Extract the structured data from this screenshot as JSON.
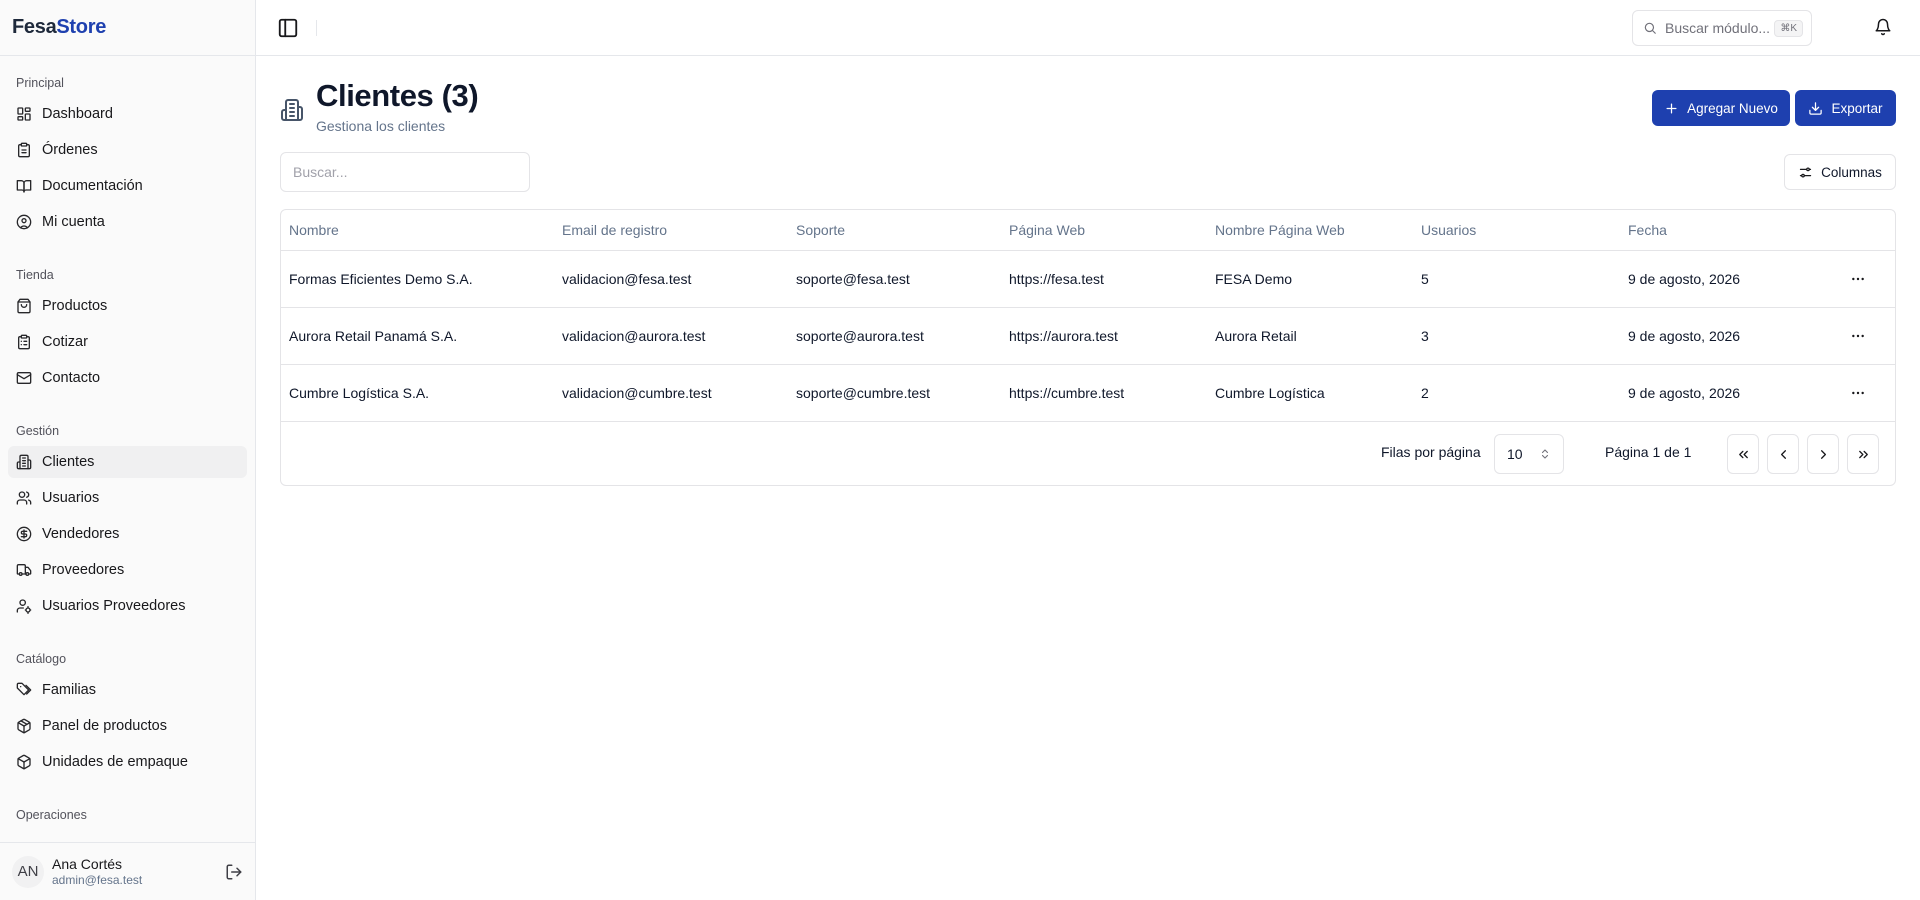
{
  "brand": {
    "part1": "Fesa",
    "part2": "Store"
  },
  "sidebar": {
    "groups": [
      {
        "label": "Principal",
        "items": [
          {
            "label": "Dashboard",
            "icon": "layout-grid-icon"
          },
          {
            "label": "Órdenes",
            "icon": "clipboard-icon"
          },
          {
            "label": "Documentación",
            "icon": "book-open-icon"
          },
          {
            "label": "Mi cuenta",
            "icon": "user-circle-icon"
          }
        ]
      },
      {
        "label": "Tienda",
        "items": [
          {
            "label": "Productos",
            "icon": "shopping-bag-icon"
          },
          {
            "label": "Cotizar",
            "icon": "clipboard-list-icon"
          },
          {
            "label": "Contacto",
            "icon": "mail-icon"
          }
        ]
      },
      {
        "label": "Gestión",
        "items": [
          {
            "label": "Clientes",
            "icon": "building-icon",
            "active": true
          },
          {
            "label": "Usuarios",
            "icon": "users-icon"
          },
          {
            "label": "Vendedores",
            "icon": "dollar-circle-icon"
          },
          {
            "label": "Proveedores",
            "icon": "truck-icon"
          },
          {
            "label": "Usuarios Proveedores",
            "icon": "user-cog-icon"
          }
        ]
      },
      {
        "label": "Catálogo",
        "items": [
          {
            "label": "Familias",
            "icon": "tags-icon"
          },
          {
            "label": "Panel de productos",
            "icon": "box-icon"
          },
          {
            "label": "Unidades de empaque",
            "icon": "package-icon"
          }
        ]
      },
      {
        "label": "Operaciones",
        "items": []
      }
    ],
    "user": {
      "initials": "AN",
      "name": "Ana Cortés",
      "email": "admin@fesa.test"
    }
  },
  "topbar": {
    "search_placeholder": "Buscar módulo...",
    "shortcut": "⌘K"
  },
  "page": {
    "title": "Clientes (3)",
    "subtitle": "Gestiona los clientes",
    "add_label": "Agregar Nuevo",
    "export_label": "Exportar",
    "search_placeholder": "Buscar...",
    "columns_label": "Columnas"
  },
  "table": {
    "headers": [
      "Nombre",
      "Email de registro",
      "Soporte",
      "Página Web",
      "Nombre Página Web",
      "Usuarios",
      "Fecha"
    ],
    "rows": [
      [
        "Formas Eficientes Demo S.A.",
        "validacion@fesa.test",
        "soporte@fesa.test",
        "https://fesa.test",
        "FESA Demo",
        "5",
        "9 de agosto, 2026"
      ],
      [
        "Aurora Retail Panamá S.A.",
        "validacion@aurora.test",
        "soporte@aurora.test",
        "https://aurora.test",
        "Aurora Retail",
        "3",
        "9 de agosto, 2026"
      ],
      [
        "Cumbre Logística S.A.",
        "validacion@cumbre.test",
        "soporte@cumbre.test",
        "https://cumbre.test",
        "Cumbre Logística",
        "2",
        "9 de agosto, 2026"
      ]
    ]
  },
  "pagination": {
    "rows_label": "Filas por página",
    "rows_value": "10",
    "page_info": "Página 1 de 1"
  },
  "colors": {
    "accent": "#1e40af",
    "brand_dark": "#1e293b"
  }
}
